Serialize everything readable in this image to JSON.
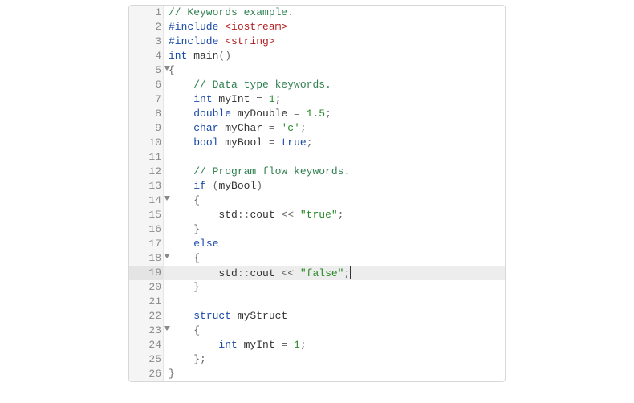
{
  "editor": {
    "activeLine": 19,
    "lines": [
      {
        "num": "1",
        "fold": false,
        "tokens": [
          [
            "cm",
            "// Keywords example."
          ]
        ]
      },
      {
        "num": "2",
        "fold": false,
        "tokens": [
          [
            "pp",
            "#include "
          ],
          [
            "inc",
            "<iostream>"
          ]
        ]
      },
      {
        "num": "3",
        "fold": false,
        "tokens": [
          [
            "pp",
            "#include "
          ],
          [
            "inc",
            "<string>"
          ]
        ]
      },
      {
        "num": "4",
        "fold": false,
        "tokens": [
          [
            "kw",
            "int"
          ],
          [
            "id",
            " main"
          ],
          [
            "op",
            "()"
          ]
        ]
      },
      {
        "num": "5",
        "fold": true,
        "tokens": [
          [
            "op",
            "{"
          ]
        ]
      },
      {
        "num": "6",
        "fold": false,
        "tokens": [
          [
            "id",
            "    "
          ],
          [
            "cm",
            "// Data type keywords."
          ]
        ]
      },
      {
        "num": "7",
        "fold": false,
        "tokens": [
          [
            "id",
            "    "
          ],
          [
            "kw",
            "int"
          ],
          [
            "id",
            " myInt "
          ],
          [
            "op",
            "= "
          ],
          [
            "num",
            "1"
          ],
          [
            "op",
            ";"
          ]
        ]
      },
      {
        "num": "8",
        "fold": false,
        "tokens": [
          [
            "id",
            "    "
          ],
          [
            "kw",
            "double"
          ],
          [
            "id",
            " myDouble "
          ],
          [
            "op",
            "= "
          ],
          [
            "num",
            "1.5"
          ],
          [
            "op",
            ";"
          ]
        ]
      },
      {
        "num": "9",
        "fold": false,
        "tokens": [
          [
            "id",
            "    "
          ],
          [
            "kw",
            "char"
          ],
          [
            "id",
            " myChar "
          ],
          [
            "op",
            "= "
          ],
          [
            "str",
            "'c'"
          ],
          [
            "op",
            ";"
          ]
        ]
      },
      {
        "num": "10",
        "fold": false,
        "tokens": [
          [
            "id",
            "    "
          ],
          [
            "kw",
            "bool"
          ],
          [
            "id",
            " myBool "
          ],
          [
            "op",
            "= "
          ],
          [
            "bool",
            "true"
          ],
          [
            "op",
            ";"
          ]
        ]
      },
      {
        "num": "11",
        "fold": false,
        "tokens": [
          [
            "id",
            ""
          ]
        ]
      },
      {
        "num": "12",
        "fold": false,
        "tokens": [
          [
            "id",
            "    "
          ],
          [
            "cm",
            "// Program flow keywords."
          ]
        ]
      },
      {
        "num": "13",
        "fold": false,
        "tokens": [
          [
            "id",
            "    "
          ],
          [
            "kw",
            "if"
          ],
          [
            "id",
            " "
          ],
          [
            "op",
            "("
          ],
          [
            "id",
            "myBool"
          ],
          [
            "op",
            ")"
          ]
        ]
      },
      {
        "num": "14",
        "fold": true,
        "tokens": [
          [
            "id",
            "    "
          ],
          [
            "op",
            "{"
          ]
        ]
      },
      {
        "num": "15",
        "fold": false,
        "tokens": [
          [
            "id",
            "        std"
          ],
          [
            "op",
            "::"
          ],
          [
            "id",
            "cout "
          ],
          [
            "op",
            "<< "
          ],
          [
            "str",
            "\"true\""
          ],
          [
            "op",
            ";"
          ]
        ]
      },
      {
        "num": "16",
        "fold": false,
        "tokens": [
          [
            "id",
            "    "
          ],
          [
            "op",
            "}"
          ]
        ]
      },
      {
        "num": "17",
        "fold": false,
        "tokens": [
          [
            "id",
            "    "
          ],
          [
            "kw",
            "else"
          ]
        ]
      },
      {
        "num": "18",
        "fold": true,
        "tokens": [
          [
            "id",
            "    "
          ],
          [
            "op",
            "{"
          ]
        ]
      },
      {
        "num": "19",
        "fold": false,
        "tokens": [
          [
            "id",
            "        std"
          ],
          [
            "op",
            "::"
          ],
          [
            "id",
            "cout "
          ],
          [
            "op",
            "<< "
          ],
          [
            "str",
            "\"false\""
          ],
          [
            "op",
            ";"
          ]
        ],
        "cursor": true
      },
      {
        "num": "20",
        "fold": false,
        "tokens": [
          [
            "id",
            "    "
          ],
          [
            "op",
            "}"
          ]
        ]
      },
      {
        "num": "21",
        "fold": false,
        "tokens": [
          [
            "id",
            ""
          ]
        ]
      },
      {
        "num": "22",
        "fold": false,
        "tokens": [
          [
            "id",
            "    "
          ],
          [
            "kw",
            "struct"
          ],
          [
            "id",
            " myStruct"
          ]
        ]
      },
      {
        "num": "23",
        "fold": true,
        "tokens": [
          [
            "id",
            "    "
          ],
          [
            "op",
            "{"
          ]
        ]
      },
      {
        "num": "24",
        "fold": false,
        "tokens": [
          [
            "id",
            "        "
          ],
          [
            "kw",
            "int"
          ],
          [
            "id",
            " myInt "
          ],
          [
            "op",
            "= "
          ],
          [
            "num",
            "1"
          ],
          [
            "op",
            ";"
          ]
        ]
      },
      {
        "num": "25",
        "fold": false,
        "tokens": [
          [
            "id",
            "    "
          ],
          [
            "op",
            "};"
          ]
        ]
      },
      {
        "num": "26",
        "fold": false,
        "tokens": [
          [
            "op",
            "}"
          ]
        ]
      }
    ]
  }
}
